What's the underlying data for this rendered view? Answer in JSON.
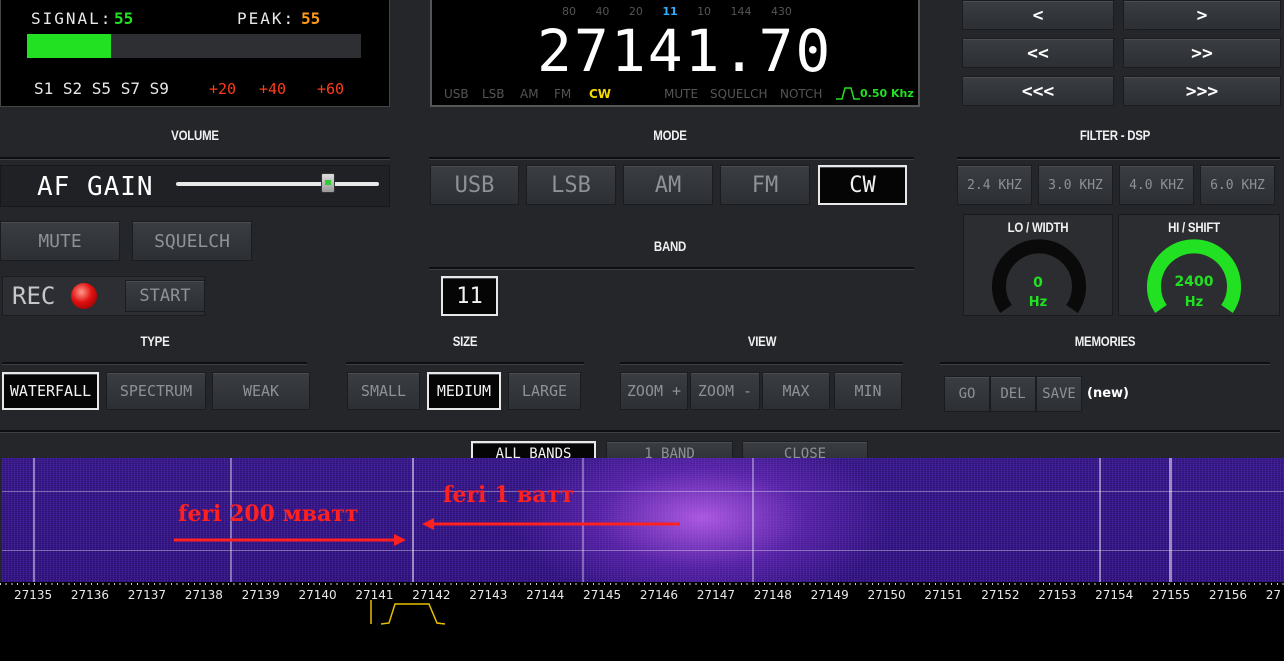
{
  "signal_panel": {
    "signal_label": "SIGNAL:",
    "signal_value": "55",
    "peak_label": "PEAK:",
    "peak_value": "55",
    "meter_level": 0.25,
    "scale_white": "S1 S2 S5 S7 S9",
    "scale_red": [
      "+20",
      "+40",
      "+60"
    ]
  },
  "freq_display": {
    "bands": [
      "80",
      "40",
      "20",
      "11",
      "10",
      "144",
      "430"
    ],
    "active_band": "11",
    "frequency": "27141.70",
    "modes": [
      "USB",
      "LSB",
      "AM",
      "FM",
      "CW"
    ],
    "active_mode": "CW",
    "flags": [
      "MUTE",
      "SQUELCH",
      "NOTCH"
    ],
    "bandwidth": "0.50 Khz"
  },
  "nav": {
    "prev": "<",
    "next": ">",
    "prev2": "<<",
    "next2": ">>",
    "prev3": "<<<",
    "next3": ">>>"
  },
  "volume": {
    "title": "VOLUME",
    "af_gain_label": "AF GAIN",
    "af_gain_value": 0.75
  },
  "mode": {
    "title": "MODE",
    "buttons": [
      "USB",
      "LSB",
      "AM",
      "FM",
      "CW"
    ]
  },
  "band": {
    "title": "BAND",
    "value": "11"
  },
  "filter": {
    "title": "FILTER - DSP",
    "buttons": [
      "2.4 KHZ",
      "3.0 KHZ",
      "4.0 KHZ",
      "6.0 KHZ"
    ],
    "lo_title": "LO / WIDTH",
    "lo_value": "0",
    "lo_unit": "Hz",
    "hi_title": "HI / SHIFT",
    "hi_value": "2400",
    "hi_unit": "Hz"
  },
  "controls": {
    "mute": "MUTE",
    "squelch": "SQUELCH",
    "rec": "REC",
    "start": "START"
  },
  "type": {
    "title": "TYPE",
    "buttons": [
      "WATERFALL",
      "SPECTRUM",
      "WEAK"
    ],
    "selected": "WATERFALL"
  },
  "size": {
    "title": "SIZE",
    "buttons": [
      "SMALL",
      "MEDIUM",
      "LARGE"
    ],
    "selected": "MEDIUM"
  },
  "view": {
    "title": "VIEW",
    "buttons": [
      "ZOOM +",
      "ZOOM -",
      "MAX",
      "MIN"
    ]
  },
  "memories": {
    "title": "MEMORIES",
    "buttons": [
      "GO",
      "DEL",
      "SAVE"
    ],
    "note": "(new)"
  },
  "waterfall_tabs": {
    "all": "ALL BANDS",
    "one": "1 BAND",
    "close": "CLOSE"
  },
  "annotations": {
    "left": "feri 200 мватт",
    "right": "feri 1 ватт"
  },
  "axis_labels": [
    "27135",
    "27136",
    "27137",
    "27138",
    "27139",
    "27140",
    "27141",
    "27142",
    "27143",
    "27144",
    "27145",
    "27146",
    "27147",
    "27148",
    "27149",
    "27150",
    "27151",
    "27152",
    "27153",
    "27154",
    "27155",
    "27156",
    "27"
  ],
  "colors": {
    "green": "#22e022",
    "orange": "#ff9a1a",
    "red": "#ff3b1a",
    "accent_blue": "#2db0ff"
  }
}
